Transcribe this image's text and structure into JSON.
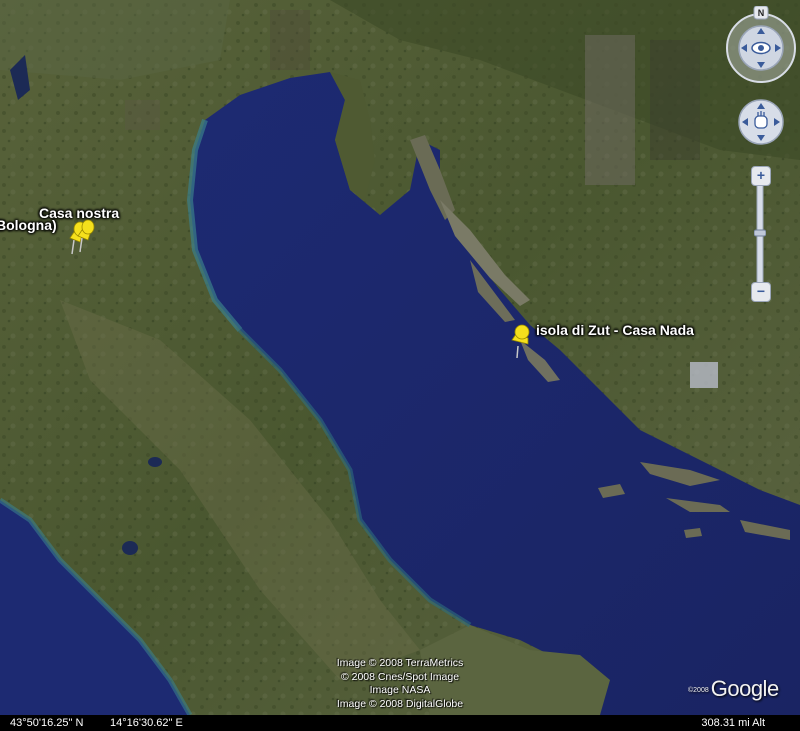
{
  "map": {
    "type": "satellite",
    "region": "Adriatic Sea",
    "placemarks": [
      {
        "label": "Casa nostra",
        "sublabel": "Bologna)",
        "pin_color": "#f5e01c",
        "count": 2
      },
      {
        "label": "isola di Zut - Casa Nada",
        "pin_color": "#f5e01c",
        "count": 1
      }
    ]
  },
  "nav": {
    "north_label": "N",
    "zoom_in": "+",
    "zoom_out": "−"
  },
  "credits": [
    "Image © 2008 TerraMetrics",
    "© 2008 Cnes/Spot Image",
    "Image NASA",
    "Image © 2008 DigitalGlobe"
  ],
  "logo": {
    "copyright": "©2008",
    "name": "Google"
  },
  "status": {
    "latitude": "43°50'16.25\" N",
    "longitude": "14°16'30.62\" E",
    "altitude": "308.31 mi Alt"
  },
  "colors": {
    "sea": "#1e2a6e",
    "land": "#4e5a2c",
    "pin": "#f5e01c",
    "statusbar": "#000000"
  },
  "icons": {
    "look": "eye-icon",
    "move": "hand-icon",
    "zoom_in": "plus-icon",
    "zoom_out": "minus-icon",
    "placemark": "pushpin-icon"
  }
}
